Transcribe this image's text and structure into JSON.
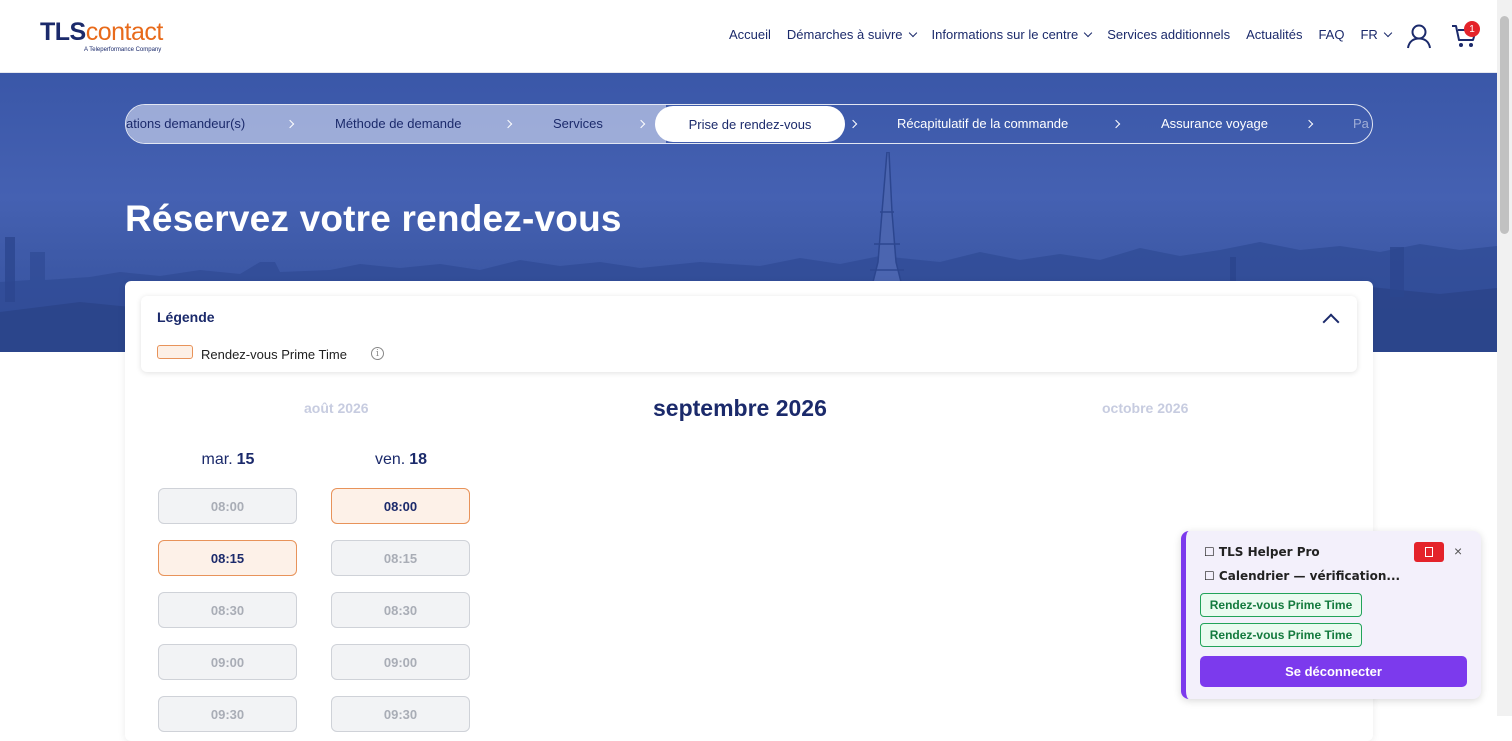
{
  "logo": {
    "brand_a": "TLS",
    "brand_b": "contact",
    "tagline": "A Teleperformance Company"
  },
  "nav": {
    "items": [
      {
        "label": "Accueil",
        "dropdown": false
      },
      {
        "label": "Démarches à suivre",
        "dropdown": true
      },
      {
        "label": "Informations sur le centre",
        "dropdown": true
      },
      {
        "label": "Services additionnels",
        "dropdown": false
      },
      {
        "label": "Actualités",
        "dropdown": false
      },
      {
        "label": "FAQ",
        "dropdown": false
      },
      {
        "label": "FR",
        "dropdown": true
      }
    ],
    "cart_count": "1"
  },
  "stepper": {
    "steps": [
      {
        "label": "ations demandeur(s)",
        "state": "done"
      },
      {
        "label": "Méthode de demande",
        "state": "done"
      },
      {
        "label": "Services",
        "state": "done"
      },
      {
        "label": "Prise de rendez-vous",
        "state": "active"
      },
      {
        "label": "Récapitulatif de la commande",
        "state": "future"
      },
      {
        "label": "Assurance voyage",
        "state": "future"
      },
      {
        "label": "Pa",
        "state": "future"
      }
    ]
  },
  "page": {
    "title": "Réservez votre rendez-vous"
  },
  "legend": {
    "title": "Légende",
    "item_label": "Rendez-vous Prime Time",
    "info_glyph": "i"
  },
  "calendar": {
    "prev_month": "août 2026",
    "current_month": "septembre 2026",
    "next_month": "octobre 2026",
    "days": [
      {
        "weekday": "mar.",
        "day": "15",
        "slots": [
          {
            "time": "08:00",
            "prime": false
          },
          {
            "time": "08:15",
            "prime": true
          },
          {
            "time": "08:30",
            "prime": false
          },
          {
            "time": "09:00",
            "prime": false
          },
          {
            "time": "09:30",
            "prime": false
          }
        ]
      },
      {
        "weekday": "ven.",
        "day": "18",
        "slots": [
          {
            "time": "08:00",
            "prime": true
          },
          {
            "time": "08:15",
            "prime": false
          },
          {
            "time": "08:30",
            "prime": false
          },
          {
            "time": "09:00",
            "prime": false
          },
          {
            "time": "09:30",
            "prime": false
          }
        ]
      }
    ]
  },
  "widget": {
    "title": "☐ TLS Helper Pro",
    "status": "☐ Calendrier — vérification...",
    "close": "×",
    "tags": [
      "Rendez-vous Prime Time",
      "Rendez-vous Prime Time"
    ],
    "logout_label": "Se déconnecter"
  },
  "colors": {
    "brand_navy": "#1b2a6b",
    "brand_orange": "#e86a1a",
    "prime_border": "#e8935a",
    "widget_accent": "#7c3aed",
    "badge_red": "#e4232a"
  }
}
